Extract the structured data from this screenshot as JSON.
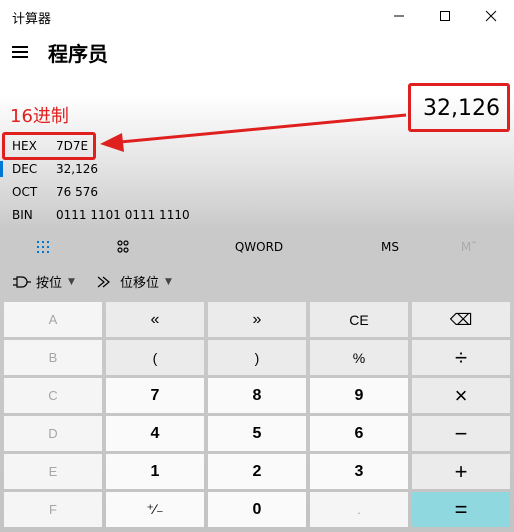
{
  "window": {
    "title": "计算器"
  },
  "header": {
    "mode_title": "程序员"
  },
  "annotation": {
    "label": "16进制"
  },
  "display": {
    "value": "32,126"
  },
  "radix": [
    {
      "name": "HEX",
      "value": "7D7E"
    },
    {
      "name": "DEC",
      "value": "32,126"
    },
    {
      "name": "OCT",
      "value": "76 576"
    },
    {
      "name": "BIN",
      "value": "0111 1101 0111 1110"
    }
  ],
  "tabs": {
    "word_size": "QWORD",
    "memory_store": "MS",
    "memory_recall": "M˘"
  },
  "toolbar": {
    "bitwise": "按位",
    "bitshift": "位移位"
  },
  "keys": [
    [
      "A",
      "«",
      "»",
      "CE",
      "⌫"
    ],
    [
      "B",
      "(",
      ")",
      "%",
      "÷"
    ],
    [
      "C",
      "7",
      "8",
      "9",
      "×"
    ],
    [
      "D",
      "4",
      "5",
      "6",
      "−"
    ],
    [
      "E",
      "1",
      "2",
      "3",
      "+"
    ],
    [
      "F",
      "⁺∕₋",
      "0",
      ".",
      "="
    ]
  ],
  "colors": {
    "accent": "#0078d4",
    "equals_bg": "#8fd8df",
    "annotation": "#e0201e"
  }
}
